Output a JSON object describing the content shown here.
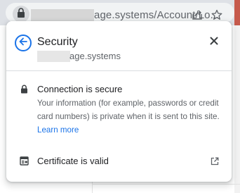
{
  "browser": {
    "url_visible": "age.systems/Account/Lo..."
  },
  "popup": {
    "title": "Security",
    "host": "age.systems",
    "connection": {
      "title": "Connection is secure",
      "description": "Your information (for example, passwords or credit card numbers) is private when it is sent to this site.",
      "learn_more": "Learn more"
    },
    "certificate": {
      "label": "Certificate is valid"
    }
  },
  "colors": {
    "accent": "#1a73e8",
    "text_primary": "#202124",
    "text_secondary": "#5f6368"
  },
  "icons": {
    "omnibox": [
      "lock-icon",
      "share-icon",
      "star-icon"
    ],
    "popup": [
      "back-arrow-icon",
      "close-icon",
      "lock-icon",
      "certificate-icon",
      "external-link-icon"
    ]
  }
}
